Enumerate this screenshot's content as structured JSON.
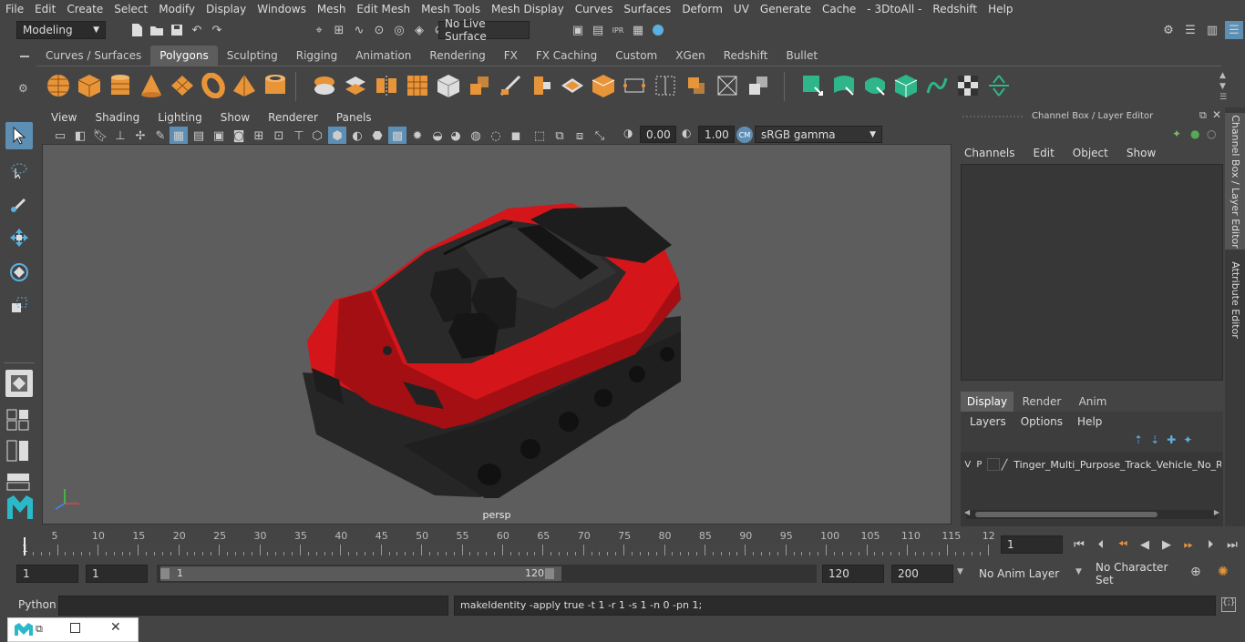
{
  "menubar": {
    "items": [
      "File",
      "Edit",
      "Create",
      "Select",
      "Modify",
      "Display",
      "Windows",
      "Mesh",
      "Edit Mesh",
      "Mesh Tools",
      "Mesh Display",
      "Curves",
      "Surfaces",
      "Deform",
      "UV",
      "Generate",
      "Cache",
      "- 3DtoAll -",
      "Redshift",
      "Help"
    ]
  },
  "statusline": {
    "mode": "Modeling",
    "live_surface": "No Live Surface"
  },
  "shelf": {
    "tabs": [
      "Curves / Surfaces",
      "Polygons",
      "Sculpting",
      "Rigging",
      "Animation",
      "Rendering",
      "FX",
      "FX Caching",
      "Custom",
      "XGen",
      "Redshift",
      "Bullet"
    ],
    "active_tab": "Polygons"
  },
  "viewport": {
    "menu": [
      "View",
      "Shading",
      "Lighting",
      "Show",
      "Renderer",
      "Panels"
    ],
    "exposure": "0.00",
    "gamma": "1.00",
    "color_space": "sRGB gamma",
    "camera_label": "persp",
    "background": "#5d5d5d",
    "accent_red": "#d4161b"
  },
  "channelbox": {
    "title": "Channel Box / Layer Editor",
    "menu": [
      "Channels",
      "Edit",
      "Object",
      "Show"
    ],
    "layer_tabs": [
      "Display",
      "Render",
      "Anim"
    ],
    "active_layer_tab": "Display",
    "layer_menu": [
      "Layers",
      "Options",
      "Help"
    ],
    "layer_row": {
      "v": "V",
      "p": "P",
      "name": "Tinger_Multi_Purpose_Track_Vehicle_No_Ro"
    }
  },
  "side_tabs": [
    "Channel Box / Layer Editor",
    "Attribute Editor"
  ],
  "timeline": {
    "labels": [
      "5",
      "10",
      "15",
      "20",
      "25",
      "30",
      "35",
      "40",
      "45",
      "50",
      "55",
      "60",
      "65",
      "70",
      "75",
      "80",
      "85",
      "90",
      "95",
      "100",
      "105",
      "110",
      "115",
      "12"
    ],
    "start_marker": "1",
    "current_frame": "1"
  },
  "range": {
    "start": "1",
    "playback_start": "1",
    "slider_start": "1",
    "slider_end": "120",
    "playback_end": "120",
    "end": "200",
    "anim_layer": "No Anim Layer",
    "character_set": "No Character Set"
  },
  "cmdline": {
    "language": "Python",
    "result": "makeIdentity -apply true -t 1 -r 1 -s 1 -n 0 -pn 1;"
  }
}
